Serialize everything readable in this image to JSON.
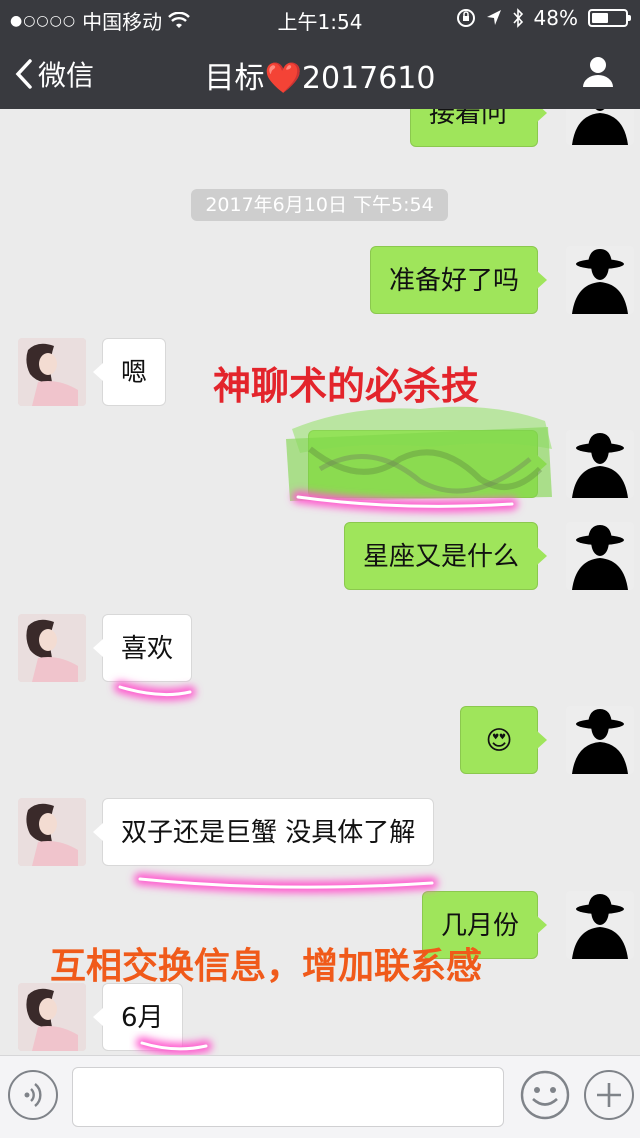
{
  "status_bar": {
    "signal": "●○○○○",
    "carrier": "中国移动",
    "time": "上午1:54",
    "battery": "48%"
  },
  "nav": {
    "back_label": "微信",
    "title_prefix": "目标",
    "title_heart": "❤️",
    "title_suffix": "2017610"
  },
  "chat": {
    "partial_top": "接着问",
    "timestamp": "2017年6月10日 下午5:54",
    "messages": [
      {
        "from": "me",
        "text": "准备好了吗"
      },
      {
        "from": "her",
        "text": "嗯"
      },
      {
        "from": "me",
        "text": ""
      },
      {
        "from": "me",
        "text": "星座又是什么"
      },
      {
        "from": "her",
        "text": "喜欢"
      },
      {
        "from": "me",
        "text": "😍"
      },
      {
        "from": "her",
        "text": "双子还是巨蟹 没具体了解"
      },
      {
        "from": "me",
        "text": "几月份"
      },
      {
        "from": "her",
        "text": "6月"
      }
    ]
  },
  "annotations": {
    "red": "神聊术的必杀技",
    "orange": "互相交换信息，增加联系感"
  },
  "colors": {
    "nav_bg": "#393a3f",
    "sent_bubble": "#9fe55b",
    "recv_bubble": "#ffffff",
    "chat_bg": "#ebebeb",
    "highlight": "#ff5ccf",
    "scribble": "#7fd64a"
  },
  "icons": {
    "back": "chevron-left-icon",
    "profile": "person-icon",
    "voice": "voice-icon",
    "emoji": "smiley-icon",
    "plus": "plus-icon"
  }
}
